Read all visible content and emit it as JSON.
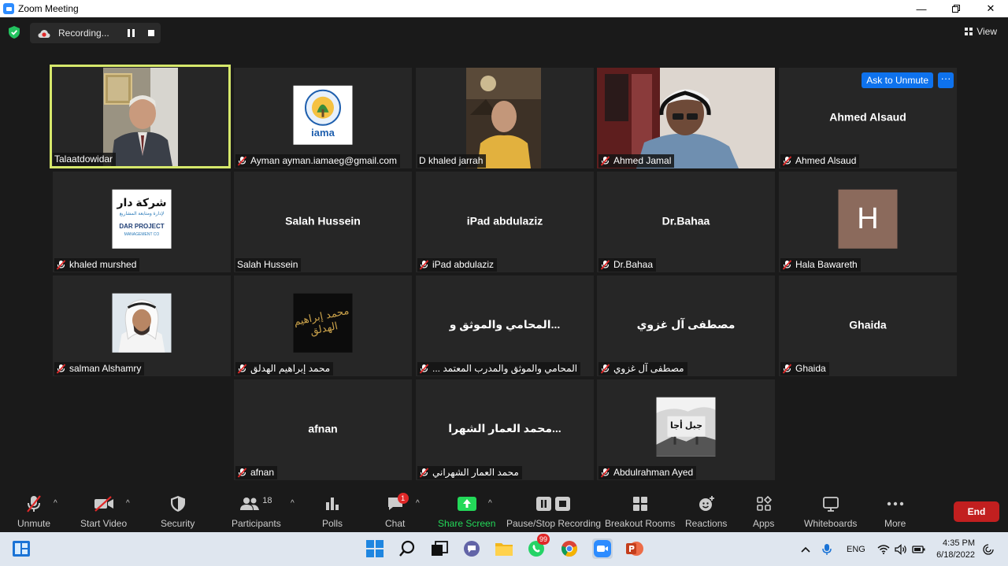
{
  "window": {
    "title": "Zoom Meeting"
  },
  "topbar": {
    "recording_label": "Recording...",
    "view_label": "View"
  },
  "tiles": [
    {
      "label": "Talaatdowidar",
      "big": "",
      "muted": false
    },
    {
      "label": "Ayman ayman.iamaeg@gmail.com",
      "big": "",
      "muted": true,
      "logo_text": "iama"
    },
    {
      "label": "D khaled jarrah",
      "big": "",
      "muted": false
    },
    {
      "label": "Ahmed Jamal",
      "big": "",
      "muted": true
    },
    {
      "label": "Ahmed Alsaud",
      "big": "Ahmed Alsaud",
      "muted": true,
      "ask_unmute": "Ask to Unmute",
      "more": "···"
    },
    {
      "label": "khaled murshed",
      "big": "",
      "muted": true,
      "logo_text_ar": "شركة دار",
      "logo_sub_ar": "لإدارة ومتابعة المشاريع",
      "logo_text_en": "DAR PROJECT",
      "logo_sub_en": "MANAGEMENT CO"
    },
    {
      "label": "Salah Hussein",
      "big": "Salah Hussein",
      "muted": false
    },
    {
      "label": "iPad abdulaziz",
      "big": "iPad abdulaziz",
      "muted": true
    },
    {
      "label": "Dr.Bahaa",
      "big": "Dr.Bahaa",
      "muted": true
    },
    {
      "label": "Hala Bawareth",
      "big": "",
      "muted": true,
      "avatar_letter": "H"
    },
    {
      "label": "salman Alshamry",
      "big": "",
      "muted": true
    },
    {
      "label": "محمد إبراهيم الهدلق",
      "big": "",
      "muted": true,
      "calligraphy": "محمد إبراهيم الهدلق"
    },
    {
      "label": "المحامي والموثق والمدرب المعتمد ...",
      "big": "...المحامي والموثق و",
      "muted": true
    },
    {
      "label": "مصطفى آل غزوي",
      "big": "مصطفى آل غزوي",
      "muted": true
    },
    {
      "label": "Ghaida",
      "big": "Ghaida",
      "muted": true
    },
    {
      "label": "afnan",
      "big": "afnan",
      "muted": true
    },
    {
      "label": "محمد العمار الشهراني",
      "big": "...محمد العمار الشهرا",
      "muted": true
    },
    {
      "label": "Abdulrahman Ayed",
      "big": "",
      "muted": true,
      "sign_text": "جبل أجا"
    }
  ],
  "toolbar": {
    "unmute": "Unmute",
    "start_video": "Start Video",
    "security": "Security",
    "participants": "Participants",
    "participants_count": "18",
    "polls": "Polls",
    "chat": "Chat",
    "chat_badge": "1",
    "share_screen": "Share Screen",
    "pause_recording": "Pause/Stop Recording",
    "breakout_rooms": "Breakout Rooms",
    "reactions": "Reactions",
    "apps": "Apps",
    "whiteboards": "Whiteboards",
    "more": "More",
    "end": "End"
  },
  "taskbar": {
    "whatsapp_badge": "99",
    "lang": "ENG",
    "time": "4:35 PM",
    "date": "6/18/2022"
  },
  "colors": {
    "active_border": "#d6e86b",
    "share_green": "#23d959",
    "end_red": "#c21f1f",
    "accent_blue": "#0e72ed"
  }
}
